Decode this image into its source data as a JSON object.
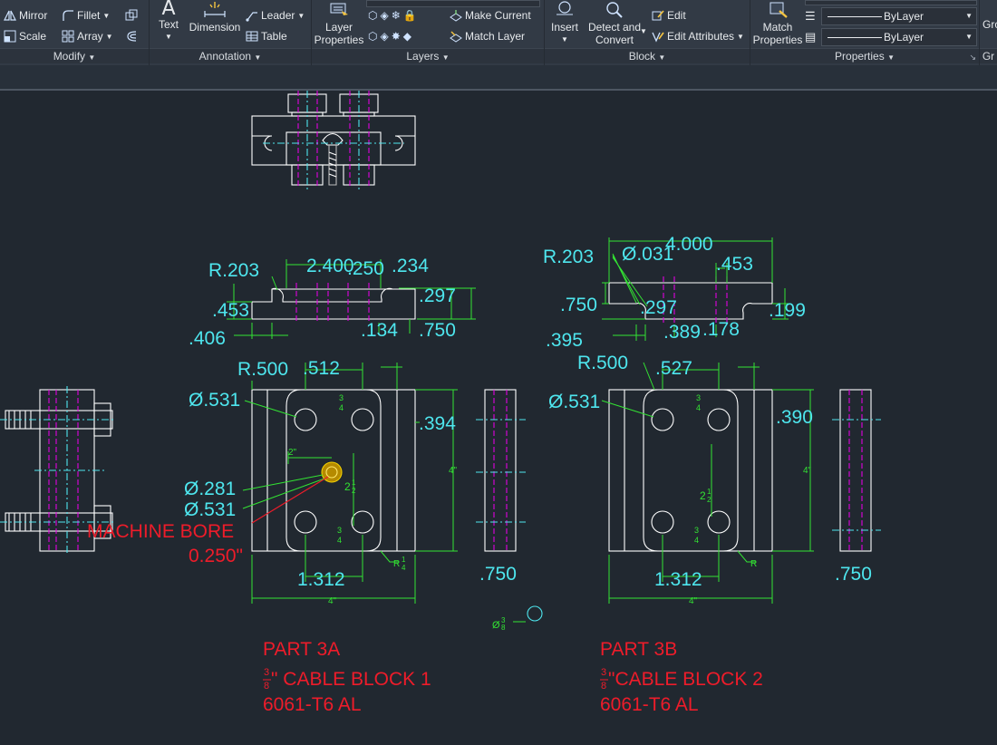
{
  "ribbon": {
    "modify": {
      "title": "Modify",
      "mirror": "Mirror",
      "fillet": "Fillet",
      "scale": "Scale",
      "array": "Array"
    },
    "annotation": {
      "title": "Annotation",
      "text": "Text",
      "dimension": "Dimension",
      "leader": "Leader",
      "table": "Table"
    },
    "layers": {
      "title": "Layers",
      "layer_properties_1": "Layer",
      "layer_properties_2": "Properties",
      "make_current": "Make Current",
      "match_layer": "Match Layer"
    },
    "block": {
      "title": "Block",
      "insert": "Insert",
      "detect_1": "Detect and",
      "detect_2": "Convert",
      "edit": "Edit",
      "edit_attributes": "Edit Attributes"
    },
    "properties": {
      "title": "Properties",
      "match_1": "Match",
      "match_2": "Properties",
      "linetype": "ByLayer",
      "lineweight": "ByLayer"
    },
    "groups": {
      "title": "Gr",
      "group": "Gro"
    }
  },
  "drawing": {
    "part_a": {
      "part": "PART 3A",
      "name_frac_num": "3",
      "name_frac_den": "8",
      "name": "\" CABLE BLOCK 1",
      "material": "6061-T6 AL",
      "machine_bore_1": "MACHINE BORE",
      "machine_bore_2": "0.250\"",
      "front": {
        "r203": "R.203",
        "d2400": "2.400",
        "d250": ".250",
        "d234": ".234",
        "d297": ".297",
        "d453": ".453",
        "d406": ".406",
        "d134": ".134",
        "d750": ".750"
      },
      "plan": {
        "r500": "R.500",
        "d512": ".512",
        "dia531a": "Ø.531",
        "d394": ".394",
        "dia281": "Ø.281",
        "dia531b": "Ø.531",
        "d1312": "1.312",
        "side750": ".750",
        "two_in": "2\"",
        "four_in_h": "4\"",
        "four_in_v": "4\"",
        "half_num": "1",
        "half_den": "4",
        "r_quarter": "R",
        "frac_34_num": "3",
        "frac_34_den": "4",
        "frac_212_whole": "2",
        "frac_212_num": "1",
        "frac_212_den": "2"
      }
    },
    "part_b": {
      "part": "PART 3B",
      "name_frac_num": "3",
      "name_frac_den": "8",
      "name": "\"CABLE BLOCK 2",
      "material": "6061-T6 AL",
      "front": {
        "r203": "R.203",
        "dia031": "Ø.031",
        "d4000": "4.000",
        "d453": ".453",
        "d750": ".750",
        "d297": ".297",
        "d199": ".199",
        "d395": ".395",
        "d389": ".389",
        "d178": ".178"
      },
      "plan": {
        "r500": "R.500",
        "d527": ".527",
        "dia531": "Ø.531",
        "d390": ".390",
        "d1312": "1.312",
        "side750": ".750",
        "four_in_h": "4\"",
        "four_in_v": "4\"",
        "r_quarter": "R",
        "frac_34_num": "3",
        "frac_34_den": "4",
        "frac_212_whole": "2",
        "frac_212_num": "1",
        "frac_212_den": "2"
      }
    },
    "misc_dia": "Ø",
    "misc_num": "3",
    "misc_den": "8"
  },
  "colors": {
    "ribbon_bg": "#323a45",
    "canvas_bg": "#212830",
    "geometry": "#ffffff",
    "dimension_text": "#4ee6ee",
    "dimension_lines": "#33e333",
    "centerlines": "#e000e0",
    "title_text": "#ee1c2a"
  }
}
